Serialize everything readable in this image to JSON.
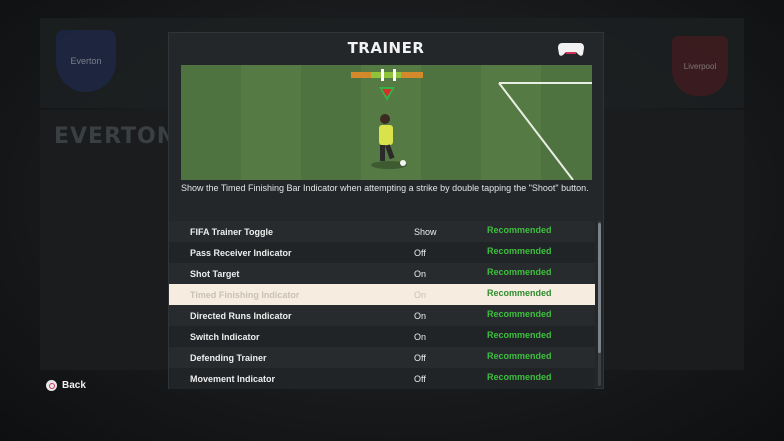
{
  "background": {
    "home_team": "EVERTON",
    "home_crest_text": "Everton",
    "away_crest_text": "Liverpool"
  },
  "modal": {
    "title": "TRAINER",
    "controller_icon": "gamepad-icon",
    "description": "Show the Timed Finishing Bar Indicator when attempting a strike by double tapping the \"Shoot\" button."
  },
  "settings": [
    {
      "name": "FIFA Trainer Toggle",
      "value": "Show",
      "tag": "Recommended",
      "selected": false
    },
    {
      "name": "Pass Receiver Indicator",
      "value": "Off",
      "tag": "Recommended",
      "selected": false
    },
    {
      "name": "Shot Target",
      "value": "On",
      "tag": "Recommended",
      "selected": false
    },
    {
      "name": "Timed Finishing Indicator",
      "value": "On",
      "tag": "Recommended",
      "selected": true
    },
    {
      "name": "Directed Runs Indicator",
      "value": "On",
      "tag": "Recommended",
      "selected": false
    },
    {
      "name": "Switch Indicator",
      "value": "On",
      "tag": "Recommended",
      "selected": false
    },
    {
      "name": "Defending Trainer",
      "value": "Off",
      "tag": "Recommended",
      "selected": false
    },
    {
      "name": "Movement Indicator",
      "value": "Off",
      "tag": "Recommended",
      "selected": false
    }
  ],
  "footer": {
    "back_label": "Back",
    "back_icon": "circle-button-icon"
  },
  "colors": {
    "accent_green": "#3fbf3f",
    "selected_row": "#f6ede0",
    "panel": "#23272a"
  }
}
